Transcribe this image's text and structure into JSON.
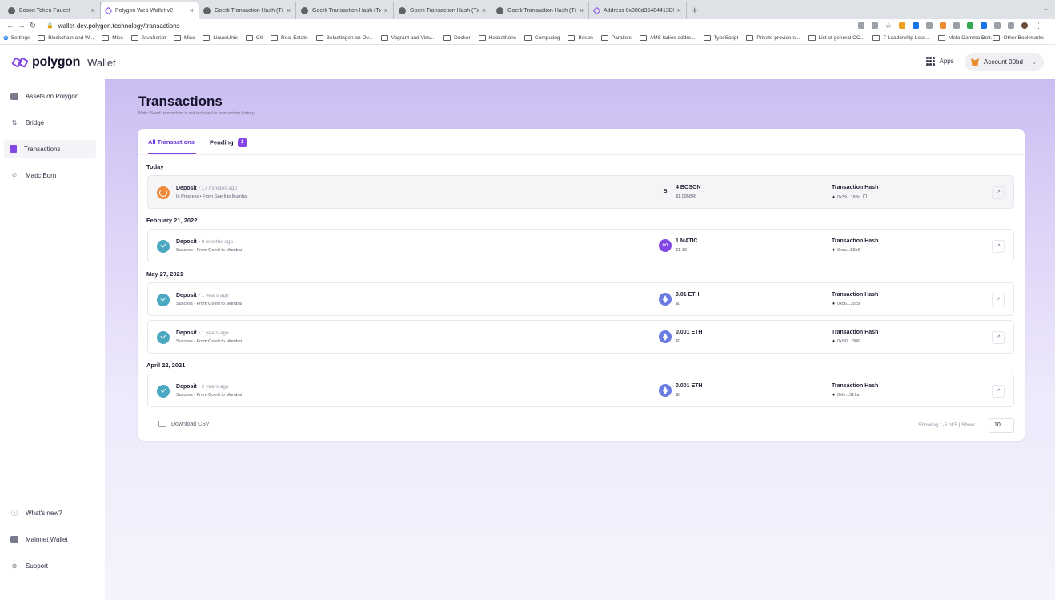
{
  "browser": {
    "tabs": [
      {
        "title": "Boson Token Faucet",
        "active": false
      },
      {
        "title": "Polygon Web Wallet v2",
        "active": true
      },
      {
        "title": "Goerli Transaction Hash (Txhas",
        "active": false
      },
      {
        "title": "Goerli Transaction Hash (Txhas",
        "active": false
      },
      {
        "title": "Goerli Transaction Hash (Txhas",
        "active": false
      },
      {
        "title": "Goerli Transaction Hash (Txhas",
        "active": false
      },
      {
        "title": "Address 0x008d35484413D9",
        "active": false
      }
    ],
    "new_tab": "+",
    "url": "wallet-dev.polygon.technology/transactions",
    "bookmarks": [
      "Settings",
      "Blockchain and W...",
      "Misc",
      "JavaScript",
      "Misc",
      "Linux/Unix",
      "Git",
      "Real Estate",
      "Belastingen on Ov...",
      "Vagrant and Virtu...",
      "Docker",
      "Hackathons",
      "Computing",
      "Boson",
      "Parallels",
      "AMS ladies addre...",
      "TypeScript",
      "Private providers...",
      "List of general CO...",
      "7 Leadership Less...",
      "Meta Gamma Delt..."
    ],
    "bookmarks_more": "»",
    "other_bookmarks": "Other Bookmarks"
  },
  "header": {
    "brand": "polygon",
    "product": "Wallet",
    "apps_label": "Apps",
    "account_label": "Account 00bd"
  },
  "sidebar": {
    "top_items": [
      {
        "label": "Assets on Polygon",
        "icon": "wallet-icon",
        "active": false
      },
      {
        "label": "Bridge",
        "icon": "bridge-icon",
        "active": false
      },
      {
        "label": "Transactions",
        "icon": "document-icon",
        "active": true
      },
      {
        "label": "Matic Burn",
        "icon": "flame-icon",
        "active": false
      }
    ],
    "bottom_items": [
      {
        "label": "What's new?",
        "icon": "info-icon"
      },
      {
        "label": "Mainnet Wallet",
        "icon": "wallet-icon"
      },
      {
        "label": "Support",
        "icon": "lifebuoy-icon"
      }
    ]
  },
  "page": {
    "title": "Transactions",
    "note": "Note: Send transaction is not included in transaction history",
    "tabs": {
      "all": "All Transactions",
      "pending": "Pending",
      "pending_count": "1"
    },
    "groups": [
      {
        "date": "Today",
        "rows": [
          {
            "type": "Deposit",
            "ago": "• 17 minutes ago",
            "sub": "In Progress • From Goerli to Mumbai",
            "status": "progress",
            "token_icon": "B",
            "token_kind": "boson",
            "amount": "4 BOSON",
            "usd": "$1.095846",
            "hash_label": "Transaction Hash",
            "hash": "0x39...188c",
            "copy": true
          }
        ]
      },
      {
        "date": "February 21, 2022",
        "rows": [
          {
            "type": "Deposit",
            "ago": "• 9 months ago",
            "sub": "Success • From Goerli to Mumbai",
            "status": "success",
            "token_icon": "",
            "token_kind": "matic",
            "amount": "1 MATIC",
            "usd": "$1.13",
            "hash_label": "Transaction Hash",
            "hash": "0xca...85b6",
            "copy": false
          }
        ]
      },
      {
        "date": "May 27, 2021",
        "rows": [
          {
            "type": "Deposit",
            "ago": "• 1 years ago",
            "sub": "Success • From Goerli to Mumbai",
            "status": "success",
            "token_icon": "",
            "token_kind": "eth",
            "amount": "0.01 ETH",
            "usd": "$0",
            "hash_label": "Transaction Hash",
            "hash": "0x56...2cc9",
            "copy": false
          },
          {
            "type": "Deposit",
            "ago": "• 1 years ago",
            "sub": "Success • From Goerli to Mumbai",
            "status": "success",
            "token_icon": "",
            "token_kind": "eth",
            "amount": "0.001 ETH",
            "usd": "$0",
            "hash_label": "Transaction Hash",
            "hash": "0xD0...f306",
            "copy": false
          }
        ]
      },
      {
        "date": "April 22, 2021",
        "rows": [
          {
            "type": "Deposit",
            "ago": "• 2 years ago",
            "sub": "Success • From Goerli to Mumbai",
            "status": "success",
            "token_icon": "",
            "token_kind": "eth",
            "amount": "0.001 ETH",
            "usd": "$0",
            "hash_label": "Transaction Hash",
            "hash": "0xfe...317a",
            "copy": false
          }
        ]
      }
    ],
    "download_csv": "Download CSV",
    "showing": "Showing 1-5 of 5 | Show:",
    "per_page": "10"
  },
  "colors": {
    "accent": "#8247e5",
    "success": "#4aa8c1",
    "progress": "#f08a3a"
  }
}
